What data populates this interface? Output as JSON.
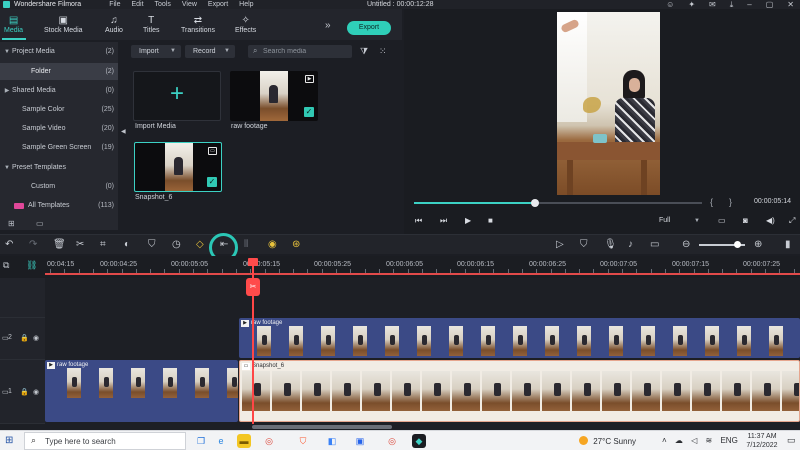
{
  "menubar": {
    "app_title": "Wondershare Filmora",
    "menu": [
      "File",
      "Edit",
      "Tools",
      "View",
      "Export",
      "Help"
    ],
    "doc_title": "Untitled : 00:00:12:28"
  },
  "library_tabs": [
    {
      "label": "Media",
      "icon": "media-folder-icon",
      "active": true
    },
    {
      "label": "Stock Media",
      "icon": "stock-media-icon",
      "active": false
    },
    {
      "label": "Audio",
      "icon": "music-note-icon",
      "active": false
    },
    {
      "label": "Titles",
      "icon": "text-T-icon",
      "active": false
    },
    {
      "label": "Transitions",
      "icon": "transitions-icon",
      "active": false
    },
    {
      "label": "Effects",
      "icon": "effects-sparkle-icon",
      "active": false
    }
  ],
  "export_label": "Export",
  "tree": [
    {
      "label": "Project Media",
      "count": "(2)",
      "expanded": true
    },
    {
      "label": "Folder",
      "count": "(2)",
      "selected": true
    },
    {
      "label": "Shared Media",
      "count": "(0)",
      "expanded": true
    },
    {
      "label": "Sample Color",
      "count": "(25)"
    },
    {
      "label": "Sample Video",
      "count": "(20)"
    },
    {
      "label": "Sample Green Screen",
      "count": "(19)"
    },
    {
      "label": "Preset Templates",
      "count": "",
      "expanded": true
    },
    {
      "label": "Custom",
      "count": "(0)"
    },
    {
      "label": "All Templates",
      "count": "(113)",
      "badge": "NEW"
    }
  ],
  "media_toolbar": {
    "import_label": "Import",
    "record_label": "Record",
    "search_placeholder": "Search media"
  },
  "media_items": [
    {
      "label": "Import Media"
    },
    {
      "label": "raw footage"
    },
    {
      "label": "Snapshot_6"
    }
  ],
  "preview": {
    "progress": 0.42,
    "timecode": "00:00:05:14",
    "quality": "Full"
  },
  "ruler": {
    "labels": [
      "00:04:15",
      "00:00:04:25",
      "00:00:05:05",
      "00:00:05:15",
      "00:00:05:25",
      "00:00:06:05",
      "00:00:06:15",
      "00:00:06:25",
      "00:00:07:05",
      "00:00:07:15",
      "00:00:07:25"
    ]
  },
  "tracks": {
    "track2_label": "2",
    "track1_label": "1",
    "clip_track2": "raw footage",
    "clip_track1_left": "raw footage",
    "clip_track1_right": "Snapshot_6"
  },
  "zoom_level": 0.82,
  "taskbar": {
    "search_placeholder": "Type here to search",
    "temperature": "27°C",
    "weather": "Sunny",
    "language": "ENG",
    "time": "11:37 AM",
    "date": "7/12/2022"
  },
  "colors": {
    "accent": "#3cd1c4",
    "playhead": "#ff4646",
    "export_button": "#2fcfb9",
    "track_clip": "#3b4a86"
  }
}
